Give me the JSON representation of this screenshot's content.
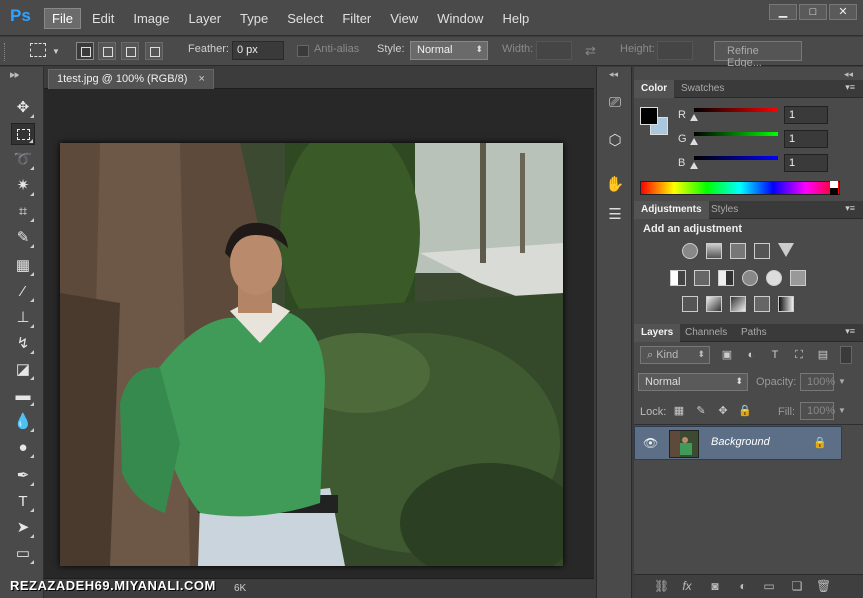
{
  "app": {
    "logo": "Ps"
  },
  "menu": [
    "File",
    "Edit",
    "Image",
    "Layer",
    "Type",
    "Select",
    "Filter",
    "View",
    "Window",
    "Help"
  ],
  "window_controls": {
    "minimize": "▁",
    "maximize": "□",
    "close": "✕"
  },
  "options": {
    "feather_label": "Feather:",
    "feather_value": "0 px",
    "antialias_label": "Anti-alias",
    "style_label": "Style:",
    "style_value": "Normal",
    "width_label": "Width:",
    "height_label": "Height:",
    "refine_edge": "Refine Edge..."
  },
  "document": {
    "tab_title": "1test.jpg @ 100% (RGB/8)",
    "tab_close": "×",
    "status": "6K"
  },
  "watermark": "REZAZADEH69.MIYANALI.COM",
  "color_panel": {
    "tabs": [
      "Color",
      "Swatches"
    ],
    "channels": [
      {
        "label": "R",
        "value": "1",
        "color": "#d40000"
      },
      {
        "label": "G",
        "value": "1",
        "color": "#00c400"
      },
      {
        "label": "B",
        "value": "1",
        "color": "#1a1aff"
      }
    ],
    "foreground": "#000000",
    "background": "#a9c8e0"
  },
  "adjustments_panel": {
    "tabs": [
      "Adjustments",
      "Styles"
    ],
    "heading": "Add an adjustment"
  },
  "layers_panel": {
    "tabs": [
      "Layers",
      "Channels",
      "Paths"
    ],
    "kind_label": "Kind",
    "blend_mode": "Normal",
    "opacity_label": "Opacity:",
    "opacity_value": "100%",
    "lock_label": "Lock:",
    "fill_label": "Fill:",
    "fill_value": "100%",
    "layers": [
      {
        "name": "Background",
        "visible": true,
        "locked": true
      }
    ]
  },
  "colors": {
    "ps_blue": "#2fa3ff",
    "selected_layer": "#5c6f86"
  }
}
